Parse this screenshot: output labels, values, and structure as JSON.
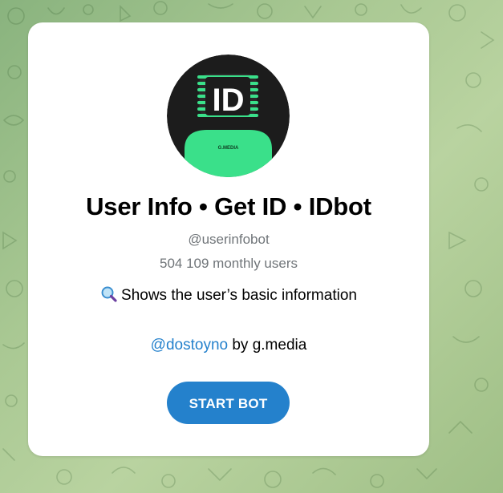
{
  "background": {
    "colors": [
      "#89b37e",
      "#b9d3a0"
    ]
  },
  "bot": {
    "avatar": {
      "logo_text": "ID",
      "shirt_text": "G.MEDIA",
      "accent_color": "#3ae08a",
      "bg_color": "#1c1c1c"
    },
    "title": "User Info • Get ID • IDbot",
    "username": "@userinfobot",
    "monthly_users": "504 109 monthly users",
    "description_icon": "magnifying-glass-icon",
    "description": "Shows the user’s basic information",
    "author_link": "@dostoyno",
    "author_suffix": " by g.media"
  },
  "actions": {
    "start_label": "START BOT",
    "start_color": "#2481cc"
  }
}
